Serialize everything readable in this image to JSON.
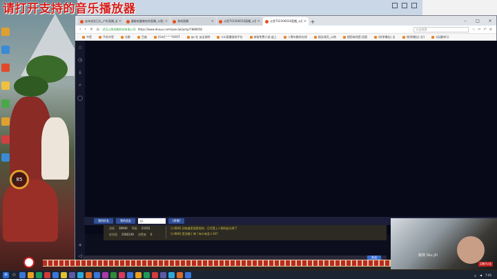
{
  "banner": {
    "text": "请打开支持的音乐播放器"
  },
  "hud": {
    "level": "85"
  },
  "back_window": {
    "title": ""
  },
  "browser": {
    "tabs": [
      {
        "label": "去年成名已久_户外直播_虎牙"
      },
      {
        "label": "最能吃最难吃的直播_斗鱼直播"
      },
      {
        "label": "游戏直播"
      },
      {
        "label": "斗鱼TV2306016直播_斗鱼直播"
      },
      {
        "label": "斗鱼TV2306016直播_斗鱼直播",
        "active": true
      }
    ],
    "address": {
      "secure_label": "武汉斗鱼网络科技有限公司",
      "url": "https://www.douyu.com/special/jump/7888658",
      "search_placeholder": "在此搜索"
    },
    "bookmarks": [
      "书签",
      "手机书签",
      "谷歌",
      "百度",
      "[Get]^^^ROOT",
      "go 在 淡出说明",
      "①①直播游戏平台",
      "来取免费小说·迷上",
      "八零年稚科在线",
      "搜全球页_斗地",
      "搜您来找是·回顾",
      "(秋季播出) 全",
      "(秋季播出) 全1",
      "(动漫排行)"
    ],
    "sidebar_icons": [
      "star-icon",
      "clock-icon",
      "download-icon",
      "search-icon",
      "chat-icon",
      "plus-icon"
    ]
  },
  "chat": {
    "buttons": [
      "我的好友",
      "我的战友"
    ],
    "input_value": "10",
    "emote_label": "[表情]",
    "send_label": "发送"
  },
  "stats": {
    "rows": [
      {
        "label": "战绩",
        "value": "38940",
        "label2": "等级",
        "value2": "23352"
      },
      {
        "label": "经验值",
        "value": "2580149",
        "label2": "消费者",
        "value2": "0"
      }
    ],
    "messages": [
      "[小啊鸡] 初始盒里面是啥的，日可登上人期间这分钟了",
      "[小啊鸡] 是亚精 [ 神 ] 有么有丢人307"
    ]
  },
  "strip_bar": {
    "action_label": "发送"
  },
  "webcam": {
    "watermark": "跑场 Sku Jill",
    "tag": "主播已认证"
  },
  "taskbar": {
    "time": "7:45",
    "date": "2018/3/8"
  }
}
